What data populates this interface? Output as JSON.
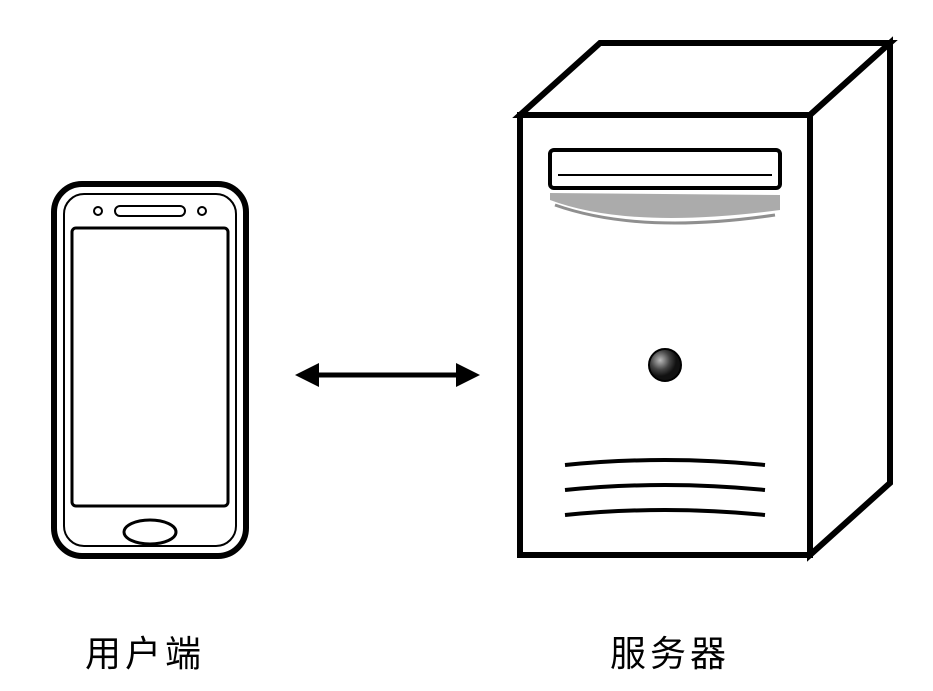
{
  "diagram": {
    "client": {
      "label": "用户端",
      "icon_name": "smartphone-icon"
    },
    "server": {
      "label": "服务器",
      "icon_name": "server-tower-icon"
    },
    "connection": {
      "type": "bidirectional-arrow",
      "icon_name": "double-arrow-icon"
    }
  }
}
